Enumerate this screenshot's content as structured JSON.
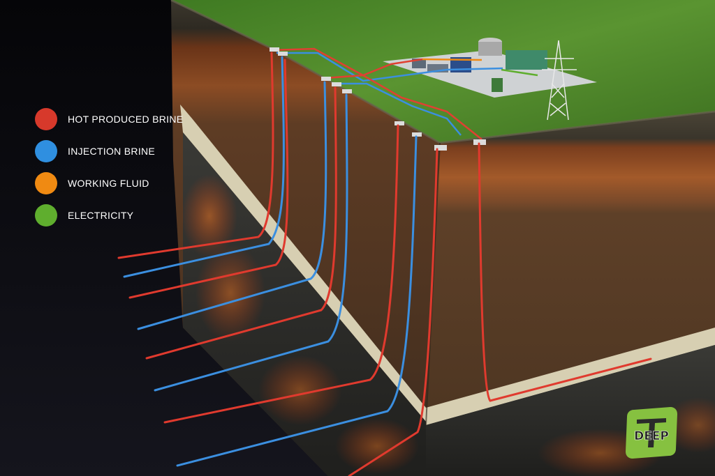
{
  "legend": {
    "items": [
      {
        "label": "HOT PRODUCED BRINE",
        "color": "#d7392b"
      },
      {
        "label": "INJECTION BRINE",
        "color": "#2f8fe0"
      },
      {
        "label": "WORKING FLUID",
        "color": "#f08a12"
      },
      {
        "label": "ELECTRICITY",
        "color": "#5fae2e"
      }
    ]
  },
  "colors": {
    "grass": "#4f8a2a",
    "topsoil": "#3a3428",
    "clay_layer": "#8a4a24",
    "brown_layer": "#5a3c26",
    "rock_band": "#d9d2b8",
    "deep_rock": "#3b3b38",
    "lava": "#e0501a",
    "pad": "#d9d9d9",
    "logo_green": "#86c140"
  },
  "logo": {
    "text": "DEEP"
  }
}
